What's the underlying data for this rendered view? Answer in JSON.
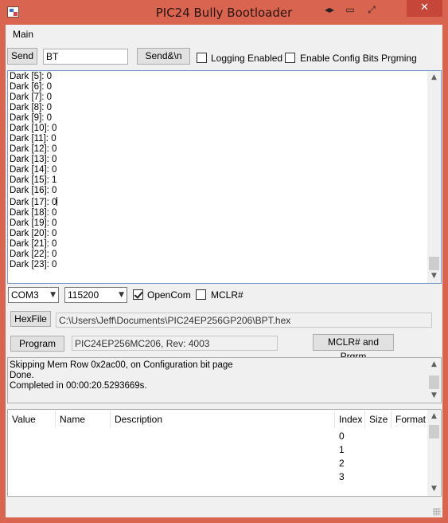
{
  "window": {
    "title": "PIC24 Bully Bootloader",
    "close_glyph": "✕"
  },
  "menu": {
    "main_label": "Main"
  },
  "send_row": {
    "send_label": "Send",
    "input_value": "BT",
    "send_newline_label": "Send&\\n",
    "logging_label": "Logging Enabled",
    "logging_checked": false,
    "config_bits_label": "Enable Config Bits Prgming",
    "config_bits_checked": false
  },
  "console": {
    "lines": [
      "Dark [5]: 0",
      "Dark [6]: 0",
      "Dark [7]: 0",
      "Dark [8]: 0",
      "Dark [9]: 0",
      "Dark [10]: 0",
      "Dark [11]: 0",
      "Dark [12]: 0",
      "Dark [13]: 0",
      "Dark [14]: 0",
      "Dark [15]: 1",
      "Dark [16]: 0",
      "Dark [17]: 0",
      "Dark [18]: 0",
      "Dark [19]: 0",
      "Dark [20]: 0",
      "Dark [21]: 0",
      "Dark [22]: 0",
      "Dark [23]: 0"
    ]
  },
  "com_row": {
    "port_value": "COM3",
    "baud_value": "115200",
    "opencom_label": "OpenCom",
    "opencom_checked": true,
    "mclr_label": "MCLR#",
    "mclr_checked": false
  },
  "hexfile": {
    "button_label": "HexFile",
    "path": "C:\\Users\\Jeff\\Documents\\PIC24EP256GP206\\BPT.hex"
  },
  "program": {
    "button_label": "Program",
    "device_info": "PIC24EP256MC206, Rev: 4003",
    "mclr_program_label": "MCLR# and Prgrm"
  },
  "log": {
    "lines": [
      "Skipping Mem Row 0x2ac00, on Configuration bit page",
      "Done.",
      "Completed in 00:00:20.5293669s."
    ]
  },
  "grid": {
    "columns": [
      "Value",
      "Name",
      "Description",
      "Index",
      "Size",
      "Format"
    ],
    "index_values": [
      "0",
      "1",
      "2",
      "3"
    ]
  }
}
